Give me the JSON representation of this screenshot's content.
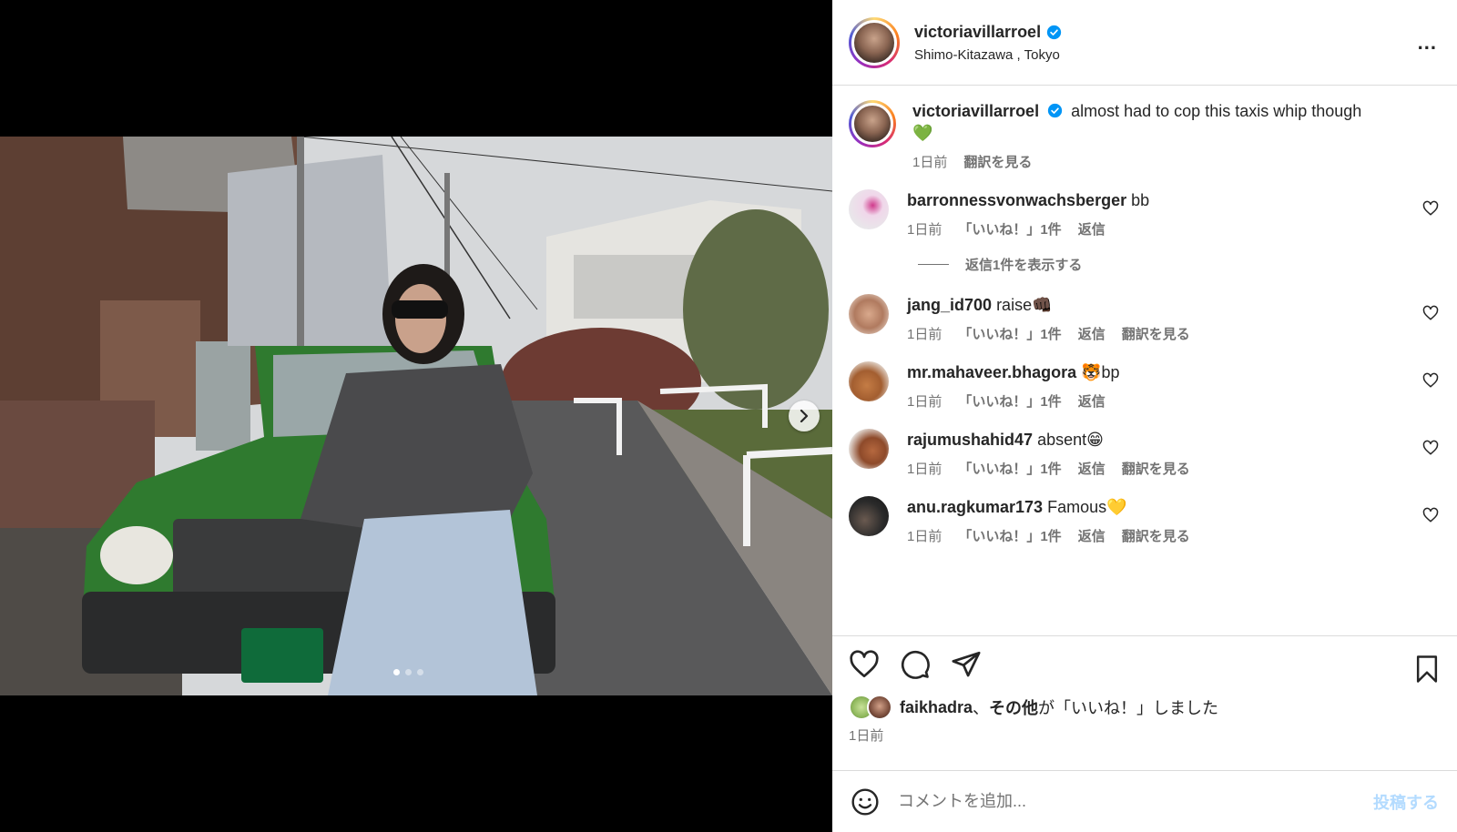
{
  "header": {
    "username": "victoriavillarroel",
    "location": "Shimo-Kitazawa , Tokyo",
    "more_label": "..."
  },
  "caption": {
    "username": "victoriavillarroel",
    "text": "almost had to cop this taxis whip though",
    "emoji": "💚",
    "time": "1日前",
    "translate": "翻訳を見る"
  },
  "comments": [
    {
      "username": "barronnessvonwachsberger",
      "text": "bb",
      "time": "1日前",
      "likes": "「いいね！」1件",
      "reply": "返信",
      "translate": "",
      "avatar_color": "#e8d8ec"
    },
    {
      "username": "jang_id700",
      "text": "raise👊🏿",
      "time": "1日前",
      "likes": "「いいね！」1件",
      "reply": "返信",
      "translate": "翻訳を見る",
      "avatar_color": "#c99a7d"
    },
    {
      "username": "mr.mahaveer.bhagora",
      "text": "🐯bp",
      "time": "1日前",
      "likes": "「いいね！」1件",
      "reply": "返信",
      "translate": "",
      "avatar_color": "#c47c45"
    },
    {
      "username": "rajumushahid47",
      "text": "absent😁",
      "time": "1日前",
      "likes": "「いいね！」1件",
      "reply": "返信",
      "translate": "翻訳を見る",
      "avatar_color": "#b5683f"
    },
    {
      "username": "anu.ragkumar173",
      "text": "Famous💛",
      "time": "1日前",
      "likes": "「いいね！」1件",
      "reply": "返信",
      "translate": "翻訳を見る",
      "avatar_color": "#3a3a3a"
    }
  ],
  "view_replies": "返信1件を表示する",
  "likes_line": {
    "user": "faikhadra",
    "sep": "、",
    "others": "その他",
    "suffix": "が「いいね！」しました",
    "time": "1日前"
  },
  "add_comment": {
    "placeholder": "コメントを追加...",
    "post_label": "投稿する"
  },
  "carousel": {
    "current": 1,
    "total": 3
  },
  "colors": {
    "verified": "#0095f6",
    "text": "#262626",
    "muted": "#737373",
    "post_disabled": "#b3dbff"
  }
}
